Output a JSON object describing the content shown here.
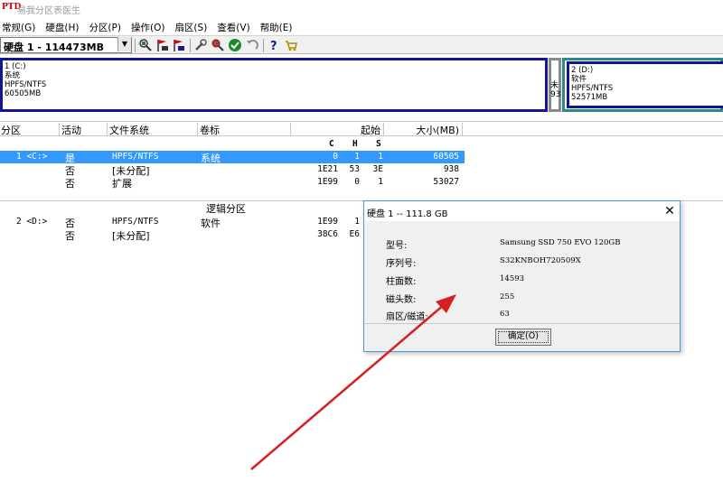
{
  "window": {
    "title": "易我分区表医生",
    "icon_text": "PTD"
  },
  "menu": [
    "常规(G)",
    "硬盘(H)",
    "分区(P)",
    "操作(O)",
    "扇区(S)",
    "查看(V)",
    "帮助(E)"
  ],
  "toolbar": {
    "disk_select_value": "硬盘 1 - 114473MB",
    "icons": [
      "zoom-disk-icon",
      "flag-red-icon",
      "flag-blue-icon",
      "wrench-icon",
      "magnifier-icon",
      "check-green-icon",
      "undo-icon",
      "help-icon",
      "cart-icon"
    ]
  },
  "disk_map": {
    "partition_c": {
      "line1": "1 (C:)",
      "line2": "系统",
      "line3": "HPFS/NTFS",
      "line4": "60505MB"
    },
    "extended": {
      "label_top": "未",
      "label_bottom": "93"
    },
    "partition_d": {
      "line1": "2 (D:)",
      "line2": "软件",
      "line3": "HPFS/NTFS",
      "line4": "52571MB"
    }
  },
  "table": {
    "headers": {
      "partition": "分区",
      "active": "活动",
      "fs": "文件系统",
      "label": "卷标",
      "start": "起始",
      "size": "大小(MB)"
    },
    "subheaders": {
      "c": "C",
      "h": "H",
      "s": "S"
    },
    "primary_rows": [
      {
        "partition": "1 <C:>",
        "active": "是",
        "fs": "HPFS/NTFS",
        "label": "系统",
        "c": "0",
        "h": "1",
        "s": "1",
        "size": "60505"
      },
      {
        "partition": "",
        "active": "否",
        "fs": "[未分配]",
        "label": "",
        "c": "1E21",
        "h": "53",
        "s": "3E",
        "size": "938"
      },
      {
        "partition": "",
        "active": "否",
        "fs": "扩展",
        "label": "",
        "c": "1E99",
        "h": "0",
        "s": "1",
        "size": "53027"
      }
    ],
    "logical_section_title": "逻辑分区",
    "logical_rows": [
      {
        "partition": "2 <D:>",
        "active": "否",
        "fs": "HPFS/NTFS",
        "label": "软件",
        "c": "1E99",
        "h": "1",
        "s": ""
      },
      {
        "partition": "",
        "active": "否",
        "fs": "[未分配]",
        "label": "",
        "c": "38C6",
        "h": "E6",
        "s": ""
      }
    ]
  },
  "dialog": {
    "title": "硬盘 1 -- 111.8 GB",
    "fields": [
      {
        "label": "型号:",
        "value": "Samsung SSD 750 EVO 120GB"
      },
      {
        "label": "序列号:",
        "value": "S32KNBOH720509X"
      },
      {
        "label": "柱面数:",
        "value": "14593"
      },
      {
        "label": "磁头数:",
        "value": "255"
      },
      {
        "label": "扇区/磁道:",
        "value": "63"
      }
    ],
    "ok_label": "确定(O)"
  },
  "colors": {
    "selection": "#3399ff",
    "partition_border": "#141496",
    "extended_border": "#2a8a8a",
    "arrow": "#d42020"
  }
}
